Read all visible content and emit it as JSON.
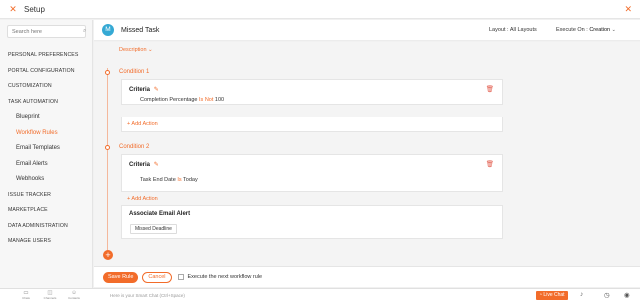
{
  "app": {
    "title": "Setup"
  },
  "sidebar": {
    "search_placeholder": "Search here",
    "items": [
      {
        "label": "PERSONAL PREFERENCES"
      },
      {
        "label": "PORTAL CONFIGURATION"
      },
      {
        "label": "CUSTOMIZATION"
      },
      {
        "label": "TASK AUTOMATION"
      }
    ],
    "sub_items": [
      {
        "label": "Blueprint"
      },
      {
        "label": "Workflow Rules"
      },
      {
        "label": "Email Templates"
      },
      {
        "label": "Email Alerts"
      },
      {
        "label": "Webhooks"
      }
    ],
    "items_after": [
      {
        "label": "ISSUE TRACKER"
      },
      {
        "label": "MARKETPLACE"
      },
      {
        "label": "DATA ADMINISTRATION"
      },
      {
        "label": "MANAGE USERS"
      }
    ]
  },
  "header": {
    "avatar_letter": "M",
    "rule_name": "Missed Task",
    "layout_label": "Layout :",
    "layout_value": "All Layouts",
    "execute_label": "Execute On :",
    "execute_value": "Creation"
  },
  "description_label": "Description",
  "conditions": [
    {
      "label": "Condition 1",
      "criteria_label": "Criteria",
      "field": "Completion Percentage",
      "operator": "Is Not",
      "value": "100",
      "add_action": "+ Add Action"
    },
    {
      "label": "Condition 2",
      "criteria_label": "Criteria",
      "field": "Task End Date",
      "operator": "Is",
      "value": "Today",
      "add_action": "+ Add Action"
    }
  ],
  "action": {
    "title": "Associate Email Alert",
    "pill": "Missed Deadline"
  },
  "footer": {
    "save": "Save Rule",
    "cancel": "Cancel",
    "checkbox_label": "Execute the next workflow rule"
  },
  "bottombar": {
    "smart_chat_placeholder": "Here is your Smart Chat (Ctrl+Space)",
    "live_chat": "Live Chat",
    "left_icons": [
      {
        "name": "chats-icon",
        "label": "Chats"
      },
      {
        "name": "channels-icon",
        "label": "Channels"
      },
      {
        "name": "contacts-icon",
        "label": "Contacts"
      }
    ]
  },
  "colors": {
    "accent": "#f26c2a",
    "avatar": "#35a9d4",
    "delete": "#e25a4b"
  }
}
